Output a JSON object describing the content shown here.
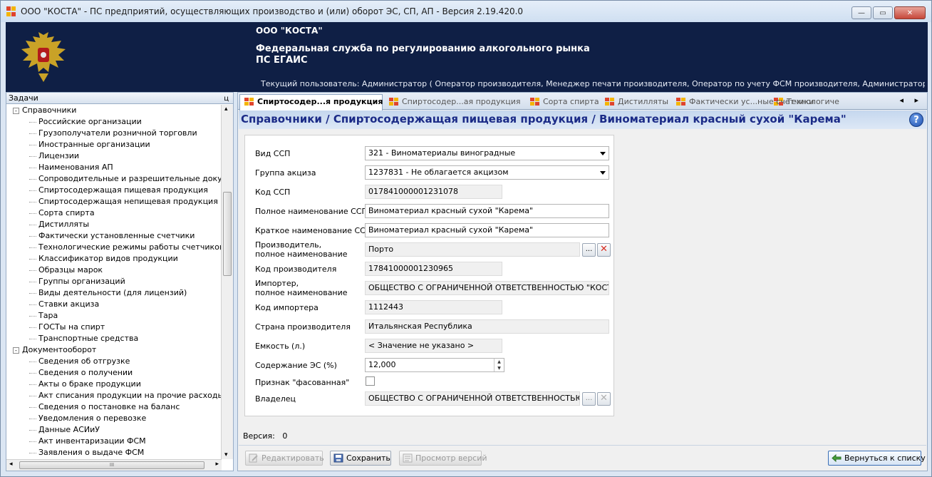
{
  "window": {
    "title": "ООО \"КОСТА\" - ПС предприятий, осуществляющих производство и (или) оборот ЭС, СП, АП - Версия 2.19.420.0",
    "controls": {
      "minimize": "—",
      "maximize": "▭",
      "close": "✕"
    }
  },
  "header": {
    "org": "ООО \"КОСТА\"",
    "service": "Федеральная служба по регулированию алкогольного рынка",
    "system": "ПС ЕГАИС",
    "current_user": "Текущий пользователь: Администратор ( Оператор производителя, Менеджер печати производителя, Оператор по учету ФСМ производителя, Администратор производителя, Опе..."
  },
  "tasks": {
    "title": "Задачи",
    "pin": "ц",
    "groups": [
      {
        "label": "Справочники",
        "expander": "-",
        "items": [
          "Российские организации",
          "Грузополучатели розничной торговли",
          "Иностранные организации",
          "Лицензии",
          "Наименования АП",
          "Сопроводительные и разрешительные документы",
          "Спиртосодержащая пищевая продукция",
          "Спиртосодержащая непищевая продукция",
          "Сорта спирта",
          "Дистилляты",
          "Фактически установленные счетчики",
          "Технологические режимы работы счетчиков",
          "Классификатор видов продукции",
          "Образцы марок",
          "Группы организаций",
          "Виды деятельности (для лицензий)",
          "Ставки акциза",
          "Тара",
          "ГОСТы на спирт",
          "Транспортные средства"
        ]
      },
      {
        "label": "Документооборот",
        "expander": "-",
        "items": [
          "Сведения об отгрузке",
          "Сведения о получении",
          "Акты о браке продукции",
          "Акт списания продукции на прочие расходы",
          "Сведения о постановке на баланс",
          "Уведомления о перевозке",
          "Данные АСИиУ",
          "Акт инвентаризации ФСМ",
          "Заявления о выдаче ФСМ"
        ]
      }
    ],
    "scroll_arrows": {
      "left": "◂",
      "right": "▸",
      "up": "▴",
      "down": "▾",
      "grip": "III"
    }
  },
  "tabs": [
    {
      "label": "Спиртосодер...я продукция",
      "active": true
    },
    {
      "label": "Спиртосодер...ая продукция",
      "active": false
    },
    {
      "label": "Сорта спирта",
      "active": false
    },
    {
      "label": "Дистилляты",
      "active": false
    },
    {
      "label": "Фактически ус...ные счетчики",
      "active": false
    },
    {
      "label": "Технологиче",
      "active": false
    }
  ],
  "tab_nav": "◂ ▸",
  "breadcrumb": "Справочники / Спиртосодержащая пищевая продукция / Виноматериал красный сухой \"Карема\"",
  "help_label": "?",
  "form": {
    "vid_ssp": {
      "label": "Вид ССП",
      "value": "321 - Виноматериалы виноградные"
    },
    "gruppa_akciza": {
      "label": "Группа акциза",
      "value": "1237831 - Не облагается акцизом"
    },
    "kod_ssp": {
      "label": "Код ССП",
      "value": "017841000001231078"
    },
    "full_name": {
      "label": "Полное наименование ССП",
      "value": "Виноматериал красный сухой \"Карема\""
    },
    "short_name": {
      "label": "Краткое наименование ССП",
      "value": "Виноматериал красный сухой \"Карема\""
    },
    "producer": {
      "label_line1": "Производитель,",
      "label_line2": "полное наименование",
      "value": "Порто"
    },
    "producer_code": {
      "label": "Код производителя",
      "value": "17841000001230965"
    },
    "importer": {
      "label_line1": "Импортер,",
      "label_line2": "полное наименование",
      "value": "ОБЩЕСТВО С ОГРАНИЧЕННОЙ ОТВЕТСТВЕННОСТЬЮ \"КОСТА\""
    },
    "importer_code": {
      "label": "Код импортера",
      "value": "1112443"
    },
    "country": {
      "label": "Страна производителя",
      "value": "Итальянская Республика"
    },
    "capacity": {
      "label": "Емкость (л.)",
      "value": "< Значение не указано >"
    },
    "es_content": {
      "label": "Содержание ЭС (%)",
      "value": "12,000",
      "spin_up": "▲",
      "spin_down": "▼"
    },
    "packaged": {
      "label": "Признак \"фасованная\"",
      "checked": false
    },
    "owner": {
      "label": "Владелец",
      "value": "ОБЩЕСТВО С ОГРАНИЧЕННОЙ ОТВЕТСТВЕННОСТЬЮ \"КОСТА\""
    },
    "browse_label": "...",
    "clear_label": "✕"
  },
  "version": {
    "label": "Версия:",
    "value": "0"
  },
  "buttons": {
    "edit": "Редактировать",
    "save": "Сохранить",
    "view_versions": "Просмотр версий",
    "back": "Вернуться к списку"
  },
  "colors": {
    "header_bg": "#0f1f45",
    "breadcrumb_text": "#1b2b87",
    "clear_red": "#d62b20"
  }
}
